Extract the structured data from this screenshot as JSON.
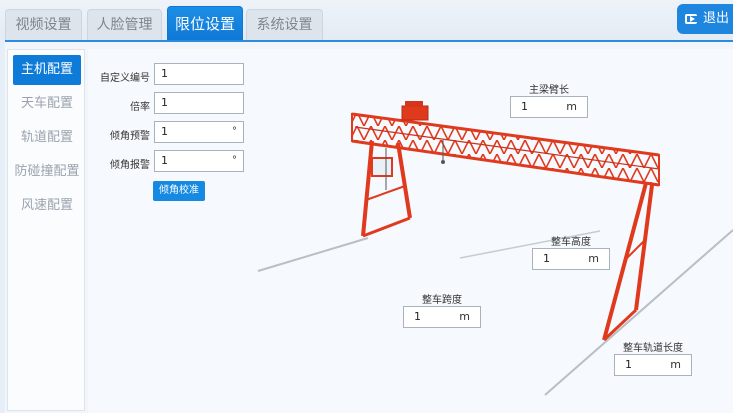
{
  "tabs": [
    {
      "label": "视频设置",
      "active": false
    },
    {
      "label": "人脸管理",
      "active": false
    },
    {
      "label": "限位设置",
      "active": true
    },
    {
      "label": "系统设置",
      "active": false
    }
  ],
  "exit_label": "退出",
  "sidebar": {
    "items": [
      {
        "label": "主机配置",
        "active": true
      },
      {
        "label": "天车配置",
        "active": false
      },
      {
        "label": "轨道配置",
        "active": false
      },
      {
        "label": "防碰撞配置",
        "active": false
      },
      {
        "label": "风速配置",
        "active": false
      }
    ]
  },
  "form": {
    "custom_id": {
      "label": "自定义编号",
      "value": "1"
    },
    "ratio": {
      "label": "倍率",
      "value": "1"
    },
    "tilt_warning": {
      "label": "倾角预警",
      "value": "1",
      "unit": "°"
    },
    "tilt_alarm": {
      "label": "倾角报警",
      "value": "1",
      "unit": "°"
    },
    "calibrate_button": "倾角校准"
  },
  "dimensions": {
    "beam_arm_length": {
      "label": "主梁臂长",
      "value": "1",
      "unit": "m"
    },
    "total_height": {
      "label": "整车高度",
      "value": "1",
      "unit": "m"
    },
    "total_span": {
      "label": "整车跨度",
      "value": "1",
      "unit": "m"
    },
    "track_length": {
      "label": "整车轨道长度",
      "value": "1",
      "unit": "m"
    }
  },
  "colors": {
    "accent": "#0f7bd8",
    "crane": "#e03a1e"
  }
}
